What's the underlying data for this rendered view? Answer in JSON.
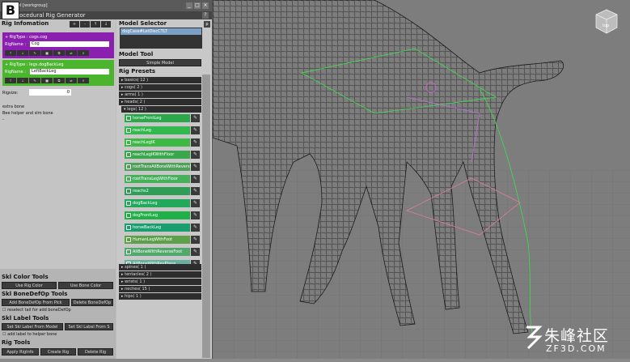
{
  "badge": "B",
  "window": {
    "title": "el [workgroup]",
    "app_title": "ocedural Rig Generator",
    "help": "?"
  },
  "rig_info": {
    "title": "Rig Infomation",
    "tools": [
      "+",
      "-",
      "↑",
      "↓"
    ],
    "box1": {
      "line1": "+ RigType : cogs.cog",
      "name_label": "RigName :",
      "name_value": "Cog",
      "color": "#8a1fb0"
    },
    "box2": {
      "line1": "+ RigType : legs.dogBackLeg",
      "name_label": "RigName :",
      "name_value": "LeftBackLeg",
      "color": "#4bb52e"
    },
    "rigsize_label": "Rigsize:",
    "rigsize_value": "0",
    "info_lines": [
      "extra bone",
      "Bee helper and slm bone",
      "-"
    ]
  },
  "skl_color": {
    "title": "Skl Color Tools",
    "btn1": "Use Rig Color",
    "btn2": "Use Bone Color"
  },
  "skl_bonedefop": {
    "title": "Skl BoneDefOp Tools",
    "btn1": "Add BoneDefOp From Pick",
    "btn2": "Delete BoneDefOp",
    "check": "reselect tail for add boneDefOp"
  },
  "skl_label": {
    "title": "Skl Label Tools",
    "btn1": "Set Skl Label From Model",
    "btn2": "Set Skl Label From S",
    "check": "add label to helper bone"
  },
  "rig_tools": {
    "title": "Rig Tools",
    "btn1": "Apply RigInfo",
    "btn2": "Create Rig",
    "btn3": "Delete Rig"
  },
  "model_selector": {
    "title": "Model Selector",
    "item": "dogCase#LetDiscCTLT",
    "pick": "p"
  },
  "model_tool": {
    "title": "Model Tool",
    "btn": "Simple Model"
  },
  "rig_presets": {
    "title": "Rig Presets",
    "cats_top": [
      "basics( 12 )",
      "cogs( 2 )",
      "arms( 1 )",
      "heads( 2 )",
      "legs( 12 )"
    ],
    "legs": [
      {
        "label": "horseFrontLeg",
        "color": "#2aa84a"
      },
      {
        "label": "reachLeg",
        "color": "#33b84e"
      },
      {
        "label": "reachLegIK",
        "color": "#3cb845"
      },
      {
        "label": "reachLegIKWithFloor",
        "color": "#3aa84a"
      },
      {
        "label": "rootTransAllBoneWithReversFoot",
        "color": "#4fa05a"
      },
      {
        "label": "rootTransLegWithFloor",
        "color": "#47b05a"
      },
      {
        "label": "reachs2",
        "color": "#2e9e56"
      },
      {
        "label": "dogBackLeg",
        "color": "#22a85a"
      },
      {
        "label": "dogFrontLeg",
        "color": "#1fb048"
      },
      {
        "label": "horseBackLeg",
        "color": "#1a9e70"
      },
      {
        "label": "HumanLegWithFoot",
        "color": "#5da04a"
      },
      {
        "label": "AllBoneWithReverseFoot",
        "color": "#52a86a"
      },
      {
        "label": "AllBoneWithRevPlane",
        "color": "#6aaea0"
      }
    ],
    "cats_bottom": [
      "spines( 1 )",
      "tentacles( 2 )",
      "wrists( 1 )",
      "neches( 15 )",
      "hips( 1 )"
    ]
  },
  "viewport": {
    "cube_label": "top",
    "watermark_cn": "朱峰社区",
    "watermark_en": "ZF3D.COM"
  }
}
